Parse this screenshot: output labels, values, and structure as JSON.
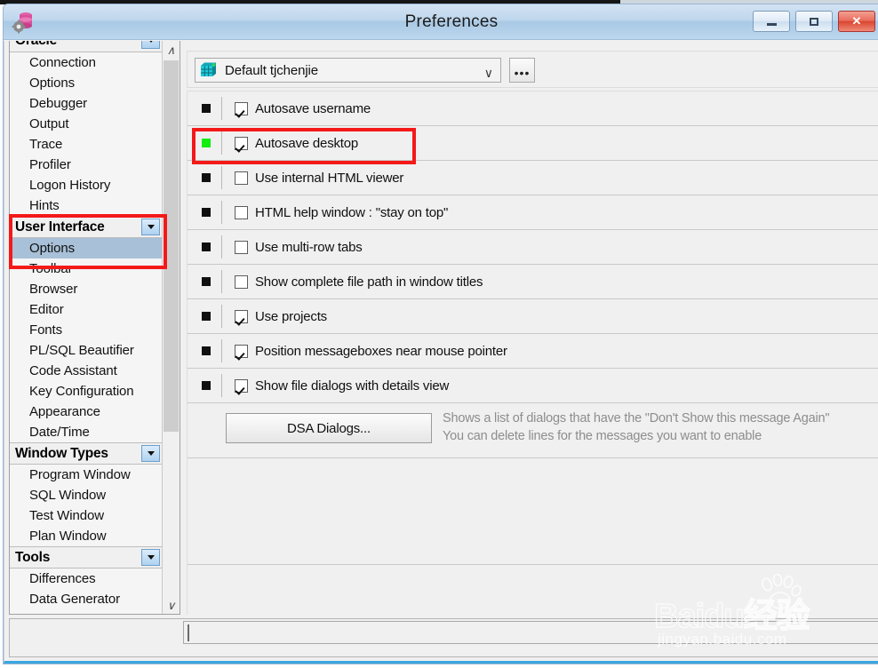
{
  "window": {
    "title": "Preferences",
    "app_icon": "database-gear-icon",
    "controls": {
      "minimize": "minimize-button",
      "maximize": "maximize-button",
      "close": "close-button"
    }
  },
  "sidebar": {
    "scroll_up_glyph": "∧",
    "scroll_down_glyph": "∨",
    "groups": [
      {
        "type": "category",
        "label": "Oracle",
        "clipped": true,
        "items": [
          "Connection",
          "Options",
          "Debugger",
          "Output",
          "Trace",
          "Profiler",
          "Logon History",
          "Hints"
        ]
      },
      {
        "type": "category",
        "label": "User Interface",
        "highlighted": true,
        "items": [
          "Options",
          "Toolbar",
          "Browser",
          "Editor",
          "Fonts",
          "PL/SQL Beautifier",
          "Code Assistant",
          "Key Configuration",
          "Appearance",
          "Date/Time"
        ],
        "selected_item": "Options"
      },
      {
        "type": "category",
        "label": "Window Types",
        "items": [
          "Program Window",
          "SQL Window",
          "Test Window",
          "Plan Window"
        ]
      },
      {
        "type": "category",
        "label": "Tools",
        "items": [
          "Differences",
          "Data Generator"
        ]
      }
    ]
  },
  "main": {
    "profile": {
      "icon": "preference-set-icon",
      "value": "Default tjchenjie",
      "caret": "∨",
      "ellipsis_label": "•••"
    },
    "options": [
      {
        "label": "Autosave username",
        "checked": true,
        "marker": "black"
      },
      {
        "label": "Autosave desktop",
        "checked": true,
        "marker": "green",
        "highlighted": true
      },
      {
        "label": "Use internal HTML viewer",
        "checked": false,
        "marker": "black"
      },
      {
        "label": "HTML help window : \"stay on top\"",
        "checked": false,
        "marker": "black"
      },
      {
        "label": "Use multi-row tabs",
        "checked": false,
        "marker": "black"
      },
      {
        "label": "Show complete file path in window titles",
        "checked": false,
        "marker": "black"
      },
      {
        "label": "Use projects",
        "checked": true,
        "marker": "black"
      },
      {
        "label": "Position messageboxes near mouse pointer",
        "checked": true,
        "marker": "black"
      },
      {
        "label": "Show file dialogs with details view",
        "checked": true,
        "marker": "black"
      }
    ],
    "dsa": {
      "button_label": "DSA Dialogs...",
      "description_line1": "Shows a list of dialogs that have the \"Don't Show this message Again\"",
      "description_line2": "You can delete lines for the messages you want to enable"
    }
  },
  "watermark": {
    "brand": "Baidu",
    "brand_cn": "经验",
    "url": "jingyan.baidu.com"
  },
  "colors": {
    "accent": "#3aa7e0",
    "annotation_red": "#f41919",
    "marker_green": "#12ee12",
    "selection_blue": "#a8c0d8",
    "titlebar_blue": "#bed6ec"
  }
}
